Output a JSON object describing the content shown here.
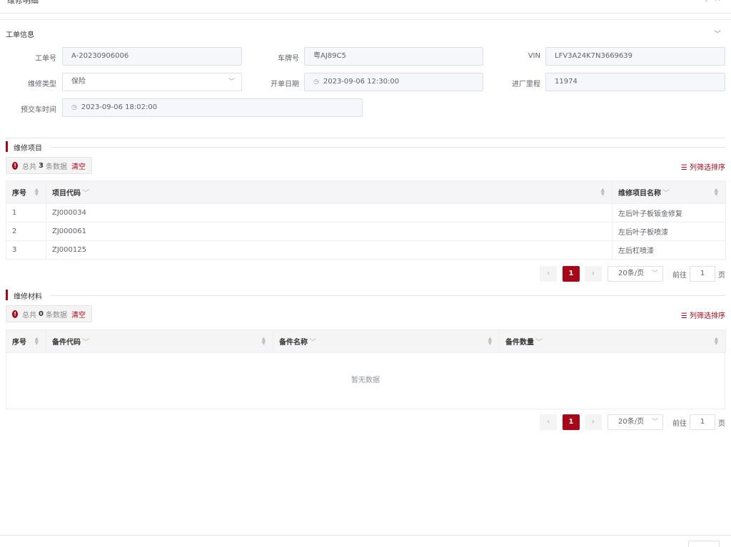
{
  "dialog": {
    "title": "维修明细"
  },
  "work_order": {
    "section_title": "工单信息",
    "fields": {
      "order_no": {
        "label": "工单号",
        "value": "A-20230906006"
      },
      "plate_no": {
        "label": "车牌号",
        "value": "粤AJ89C5"
      },
      "vin": {
        "label": "VIN",
        "value": "LFV3A24K7N3669639"
      },
      "repair_type": {
        "label": "维修类型",
        "value": "保险"
      },
      "open_date": {
        "label": "开单日期",
        "value": "2023-09-06 12:30:00"
      },
      "mileage": {
        "label": "进厂里程",
        "value": "11974"
      },
      "delivery_time": {
        "label": "预交车时间",
        "value": "2023-09-06 18:02:00"
      }
    }
  },
  "repair_items": {
    "section_title": "维修项目",
    "summary": {
      "prefix": "总共",
      "count": "3",
      "suffix": "条数据",
      "clear": "清空"
    },
    "column_filter": "列筛选排序",
    "columns": [
      "序号",
      "项目代码",
      "维修项目名称"
    ],
    "rows": [
      {
        "no": "1",
        "code": "ZJ000034",
        "name": "左后叶子板钣金修复"
      },
      {
        "no": "2",
        "code": "ZJ000061",
        "name": "左后叶子板喷漆"
      },
      {
        "no": "3",
        "code": "ZJ000125",
        "name": "左后杠喷漆"
      }
    ],
    "pagination": {
      "current": "1",
      "page_size": "20条/页",
      "goto_label": "前往",
      "goto_value": "1",
      "page_unit": "页"
    }
  },
  "repair_materials": {
    "section_title": "维修材料",
    "summary": {
      "prefix": "总共",
      "count": "0",
      "suffix": "条数据",
      "clear": "清空"
    },
    "column_filter": "列筛选排序",
    "columns": [
      "序号",
      "备件代码",
      "备件名称",
      "备件数量"
    ],
    "empty_text": "暂无数据",
    "pagination": {
      "current": "1",
      "page_size": "20条/页",
      "goto_label": "前往",
      "goto_value": "1",
      "page_unit": "页"
    }
  },
  "colors": {
    "accent": "#a8071a"
  }
}
